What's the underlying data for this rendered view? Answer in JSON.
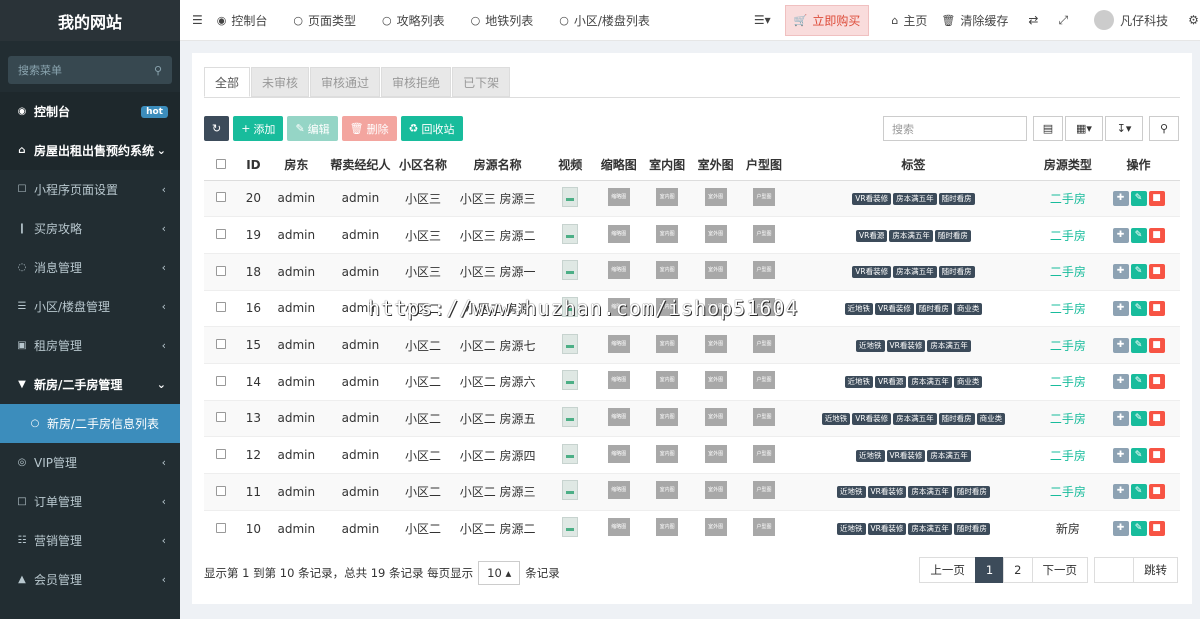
{
  "sidebar": {
    "brand": "我的网站",
    "search_placeholder": "搜索菜单",
    "items": [
      {
        "label": "控制台",
        "icon": "dashboard-icon",
        "badge": "hot",
        "cls": "top"
      },
      {
        "label": "房屋出租出售预约系统",
        "icon": "home-icon",
        "cls": "top"
      },
      {
        "label": "小程序页面设置",
        "icon": "bookmark-icon",
        "cls": "sub"
      },
      {
        "label": "买房攻略",
        "icon": "file-icon",
        "cls": "sub"
      },
      {
        "label": "消息管理",
        "icon": "comment-icon",
        "cls": "sub"
      },
      {
        "label": "小区/楼盘管理",
        "icon": "list-icon",
        "cls": "sub"
      },
      {
        "label": "租房管理",
        "icon": "save-icon",
        "cls": "sub"
      },
      {
        "label": "新房/二手房管理",
        "icon": "map-marker-icon",
        "cls": "open"
      },
      {
        "label": "新房/二手房信息列表",
        "icon": "circle-icon",
        "cls": "active"
      },
      {
        "label": "VIP管理",
        "icon": "dribbble-icon",
        "cls": "sub"
      },
      {
        "label": "订单管理",
        "icon": "edit-icon",
        "cls": "sub"
      },
      {
        "label": "营销管理",
        "icon": "list-alt-icon",
        "cls": "sub"
      },
      {
        "label": "会员管理",
        "icon": "user-icon",
        "cls": "sub"
      }
    ]
  },
  "topbar": {
    "nav": [
      "控制台",
      "页面类型",
      "攻略列表",
      "地铁列表",
      "小区/楼盘列表"
    ],
    "buy": "立即购买",
    "home": "主页",
    "clear_cache": "清除缓存",
    "user": "凡仔科技"
  },
  "tabs": [
    "全部",
    "未审核",
    "审核通过",
    "审核拒绝",
    "已下架"
  ],
  "toolbar": {
    "add": "添加",
    "edit": "编辑",
    "delete": "删除",
    "recycle": "回收站",
    "search_placeholder": "搜索"
  },
  "table": {
    "headers": [
      "ID",
      "房东",
      "帮卖经纪人",
      "小区名称",
      "房源名称",
      "视频",
      "缩略图",
      "室内图",
      "室外图",
      "户型图",
      "标签",
      "房源类型",
      "操作"
    ],
    "thumb_texts": [
      "缩略图",
      "室内图",
      "室外图",
      "户型图"
    ],
    "rows": [
      {
        "id": "20",
        "landlord": "admin",
        "agent": "admin",
        "community": "小区三",
        "name": "小区三 房源三",
        "tags": [
          "VR看装修",
          "房本满五年",
          "随时看房"
        ],
        "type": "二手房"
      },
      {
        "id": "19",
        "landlord": "admin",
        "agent": "admin",
        "community": "小区三",
        "name": "小区三 房源二",
        "tags": [
          "VR看源",
          "房本满五年",
          "随时看房"
        ],
        "type": "二手房"
      },
      {
        "id": "18",
        "landlord": "admin",
        "agent": "admin",
        "community": "小区三",
        "name": "小区三 房源一",
        "tags": [
          "VR看装修",
          "房本满五年",
          "随时看房"
        ],
        "type": "二手房"
      },
      {
        "id": "16",
        "landlord": "admin",
        "agent": "admin",
        "community": "小区二",
        "name": "小区二 房源",
        "tags": [
          "近地铁",
          "VR看装修",
          "随时看房",
          "商业类"
        ],
        "type": "二手房"
      },
      {
        "id": "15",
        "landlord": "admin",
        "agent": "admin",
        "community": "小区二",
        "name": "小区二 房源七",
        "tags": [
          "近地铁",
          "VR看装修",
          "房本满五年"
        ],
        "type": "二手房"
      },
      {
        "id": "14",
        "landlord": "admin",
        "agent": "admin",
        "community": "小区二",
        "name": "小区二 房源六",
        "tags": [
          "近地铁",
          "VR看源",
          "房本满五年",
          "商业类"
        ],
        "type": "二手房"
      },
      {
        "id": "13",
        "landlord": "admin",
        "agent": "admin",
        "community": "小区二",
        "name": "小区二 房源五",
        "tags": [
          "近地铁",
          "VR看装修",
          "房本满五年",
          "随时看房",
          "商业类"
        ],
        "type": "二手房"
      },
      {
        "id": "12",
        "landlord": "admin",
        "agent": "admin",
        "community": "小区二",
        "name": "小区二 房源四",
        "tags": [
          "近地铁",
          "VR看装修",
          "房本满五年"
        ],
        "type": "二手房"
      },
      {
        "id": "11",
        "landlord": "admin",
        "agent": "admin",
        "community": "小区二",
        "name": "小区二 房源三",
        "tags": [
          "近地铁",
          "VR看装修",
          "房本满五年",
          "随时看房"
        ],
        "type": "二手房"
      },
      {
        "id": "10",
        "landlord": "admin",
        "agent": "admin",
        "community": "小区二",
        "name": "小区二 房源二",
        "tags": [
          "近地铁",
          "VR看装修",
          "房本满五年",
          "随时看房"
        ],
        "type": "新房"
      }
    ]
  },
  "pagination": {
    "info_prefix": "显示第 1 到第 10 条记录，总共 19 条记录 每页显示",
    "page_size": "10",
    "info_suffix": "条记录",
    "prev": "上一页",
    "pages": [
      "1",
      "2"
    ],
    "next": "下一页",
    "jump": "跳转"
  },
  "watermark": "https://www.huzhan.com/ishop51604",
  "colors": {
    "sidebar": "#222d32",
    "active": "#3c8dbc",
    "add": "#18bc9c",
    "edit": "#95d5c6",
    "delete": "#f3a59f",
    "recycle": "#18bc9c",
    "refresh": "#3c4b5a",
    "move": "#8da2b3",
    "op_edit": "#18bc9c",
    "op_del": "#f75444"
  }
}
